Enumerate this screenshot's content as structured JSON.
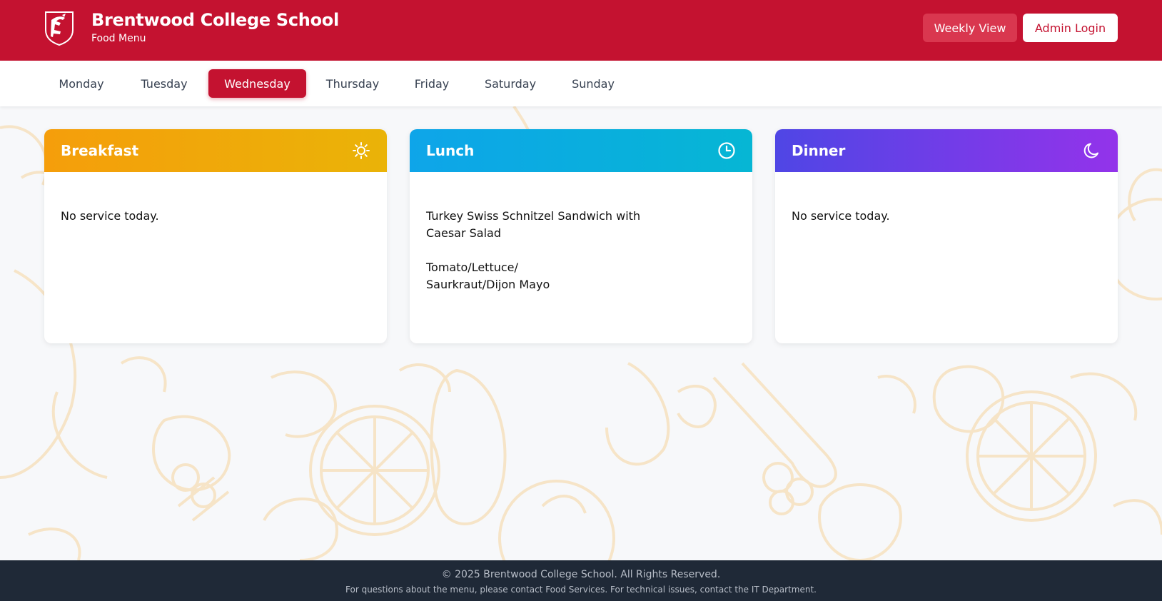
{
  "header": {
    "title": "Brentwood College School",
    "subtitle": "Food Menu",
    "weekly_view_label": "Weekly View",
    "admin_login_label": "Admin Login",
    "brand_color": "#c41230"
  },
  "days": {
    "selected": "Wednesday",
    "items": [
      "Monday",
      "Tuesday",
      "Wednesday",
      "Thursday",
      "Friday",
      "Saturday",
      "Sunday"
    ]
  },
  "meals": {
    "breakfast": {
      "title": "Breakfast",
      "icon": "sun-icon",
      "text": "No service today."
    },
    "lunch": {
      "title": "Lunch",
      "icon": "clock-icon",
      "lines": [
        "Turkey Swiss Schnitzel Sandwich with",
        "Caesar Salad",
        "",
        "Tomato/Lettuce/",
        "Saurkraut/Dijon Mayo"
      ]
    },
    "dinner": {
      "title": "Dinner",
      "icon": "moon-icon",
      "text": "No service today."
    }
  },
  "footer": {
    "copyright": "© 2025 Brentwood College School. All Rights Reserved.",
    "contact": "For questions about the menu, please contact Food Services. For technical issues, contact the IT Department."
  }
}
